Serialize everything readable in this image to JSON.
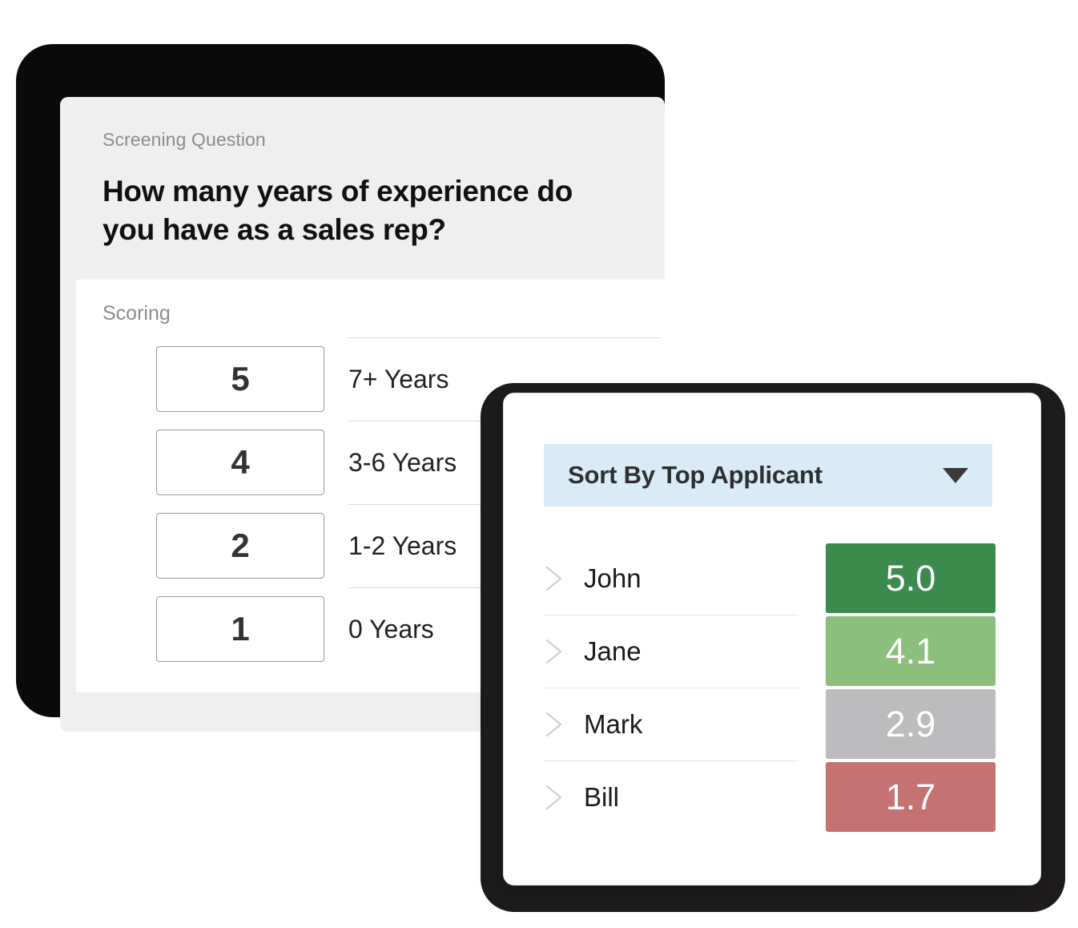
{
  "screening": {
    "eyebrow": "Screening Question",
    "question": "How many years of experience do you have as a sales rep?",
    "scoring_label": "Scoring",
    "rows": [
      {
        "score": "5",
        "answer": "7+ Years"
      },
      {
        "score": "4",
        "answer": "3-6 Years"
      },
      {
        "score": "2",
        "answer": "1-2 Years"
      },
      {
        "score": "1",
        "answer": "0 Years"
      }
    ]
  },
  "applicants": {
    "sort_label": "Sort By Top Applicant",
    "caret_icon": "chevron-down-icon",
    "rows": [
      {
        "name": "John",
        "score": "5.0",
        "color": "#3d8a4e",
        "expand_icon": "chevron-right-icon"
      },
      {
        "name": "Jane",
        "score": "4.1",
        "color": "#8cbe7e",
        "expand_icon": "chevron-right-icon"
      },
      {
        "name": "Mark",
        "score": "2.9",
        "color": "#bcbcbe",
        "expand_icon": "chevron-right-icon"
      },
      {
        "name": "Bill",
        "score": "1.7",
        "color": "#c67273",
        "expand_icon": "chevron-right-icon"
      }
    ]
  },
  "colors": {
    "header_blue": "#d8ebf7",
    "card_gray": "#efefef",
    "frame_black": "#0a0a0a",
    "score_excellent": "#3d8a4e",
    "score_good": "#8cbe7e",
    "score_neutral": "#bcbcbe",
    "score_poor": "#c67273"
  }
}
